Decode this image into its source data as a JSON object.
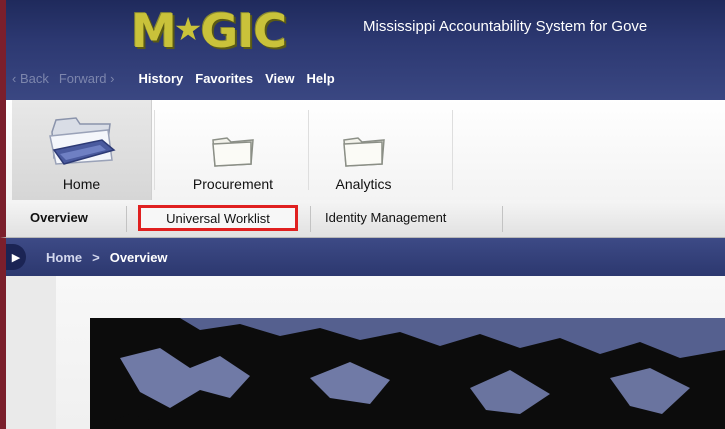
{
  "header": {
    "logo_text_left": "M",
    "logo_text_right": "GIC",
    "app_title": "Mississippi Accountability System for Gove"
  },
  "menubar": {
    "back": "‹ Back",
    "forward": "Forward ›",
    "items": [
      "History",
      "Favorites",
      "View",
      "Help"
    ]
  },
  "workcenters": [
    {
      "label": "Home",
      "icon": "home-folder-icon",
      "selected": true
    },
    {
      "label": "Procurement",
      "icon": "folder-icon",
      "selected": false
    },
    {
      "label": "Analytics",
      "icon": "folder-icon",
      "selected": false
    }
  ],
  "tabs": [
    {
      "label": "Overview",
      "active": true
    },
    {
      "label": "Universal Worklist",
      "highlighted": true
    },
    {
      "label": "Identity Management",
      "active": false
    }
  ],
  "breadcrumb": {
    "items": [
      "Home",
      "Overview"
    ],
    "separator": ">"
  },
  "colors": {
    "header_blue": "#2c3871",
    "logo_gold": "#c9c23a",
    "highlight_red": "#e02020",
    "left_accent": "#7b1f2c"
  }
}
